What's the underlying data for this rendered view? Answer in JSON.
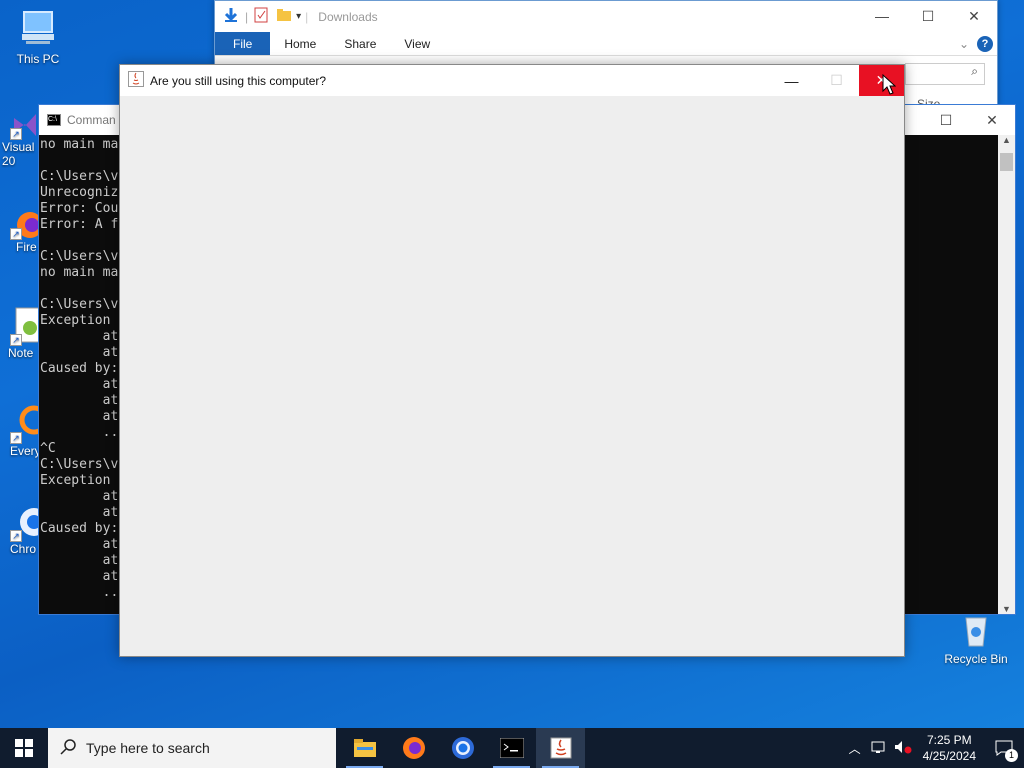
{
  "desktop": {
    "icons": [
      {
        "label": "This PC"
      },
      {
        "label": "Visual\n20"
      },
      {
        "label": "Fire"
      },
      {
        "label": "Note"
      },
      {
        "label": "Every"
      },
      {
        "label": "Chro"
      }
    ],
    "recycle_bin": "Recycle Bin"
  },
  "explorer": {
    "title": "Downloads",
    "tabs": [
      "File",
      "Home",
      "Share",
      "View"
    ],
    "column": "Size"
  },
  "cmd": {
    "title": "Comman",
    "lines": [
      "no main ma",
      "",
      "C:\\Users\\v",
      "Unrecogniz",
      "Error: Cou",
      "Error: A f",
      "",
      "C:\\Users\\v",
      "no main ma",
      "",
      "C:\\Users\\v",
      "Exception",
      "        at",
      "        at",
      "Caused by:",
      "        at",
      "        at",
      "        at",
      "        ..",
      "^C",
      "C:\\Users\\v",
      "Exception",
      "        at",
      "        at",
      "Caused by:",
      "        at",
      "        at",
      "        at",
      "        .."
    ]
  },
  "dialog": {
    "title": "Are you still using this computer?"
  },
  "taskbar": {
    "search_placeholder": "Type here to search",
    "time": "7:25 PM",
    "date": "4/25/2024",
    "notification_count": "1"
  },
  "colors": {
    "close_red": "#e81123",
    "taskbar": "#101c2e",
    "file_tab": "#1a63b7"
  }
}
